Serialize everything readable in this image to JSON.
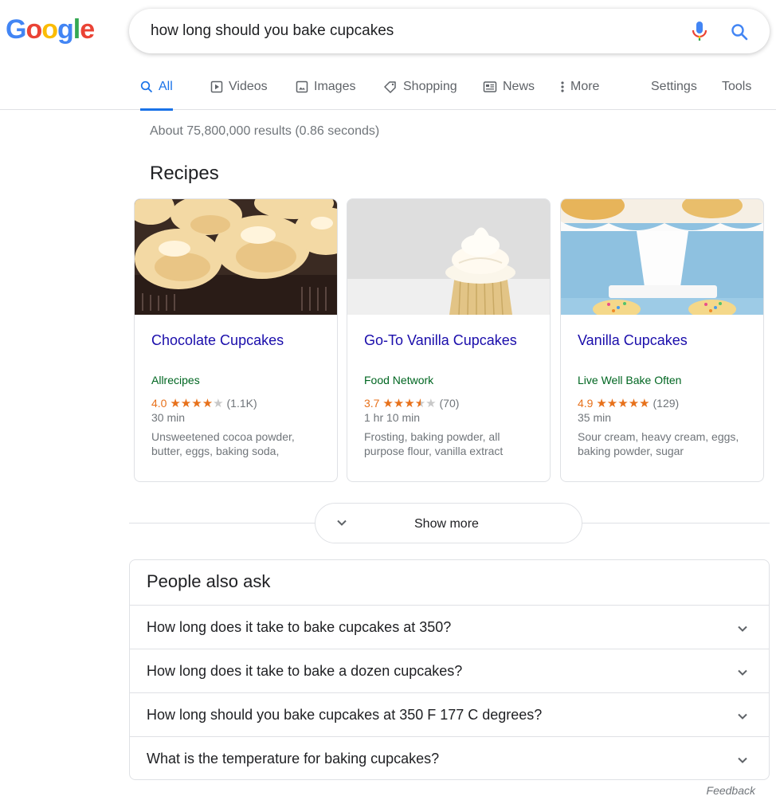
{
  "logo": {
    "letters": [
      "G",
      "o",
      "o",
      "g",
      "l",
      "e"
    ],
    "colors": [
      "#4285f4",
      "#ea4335",
      "#fbbc05",
      "#4285f4",
      "#34a853",
      "#ea4335"
    ]
  },
  "search": {
    "query": "how long should you bake cupcakes"
  },
  "tabs": [
    {
      "label": "All",
      "icon": "search-icon",
      "active": true
    },
    {
      "label": "Videos",
      "icon": "play-icon"
    },
    {
      "label": "Images",
      "icon": "image-icon"
    },
    {
      "label": "Shopping",
      "icon": "tag-icon"
    },
    {
      "label": "News",
      "icon": "news-icon"
    },
    {
      "label": "More",
      "icon": "more-vert-icon"
    },
    {
      "label": "Settings"
    },
    {
      "label": "Tools"
    }
  ],
  "results_stats": "About 75,800,000 results (0.86 seconds)",
  "recipes": {
    "heading": "Recipes",
    "cards": [
      {
        "title": "Chocolate Cupcakes",
        "source": "Allrecipes",
        "rating": "4.0",
        "stars": 4.0,
        "count": "(1.1K)",
        "time": "30 min",
        "ingredients": "Unsweetened cocoa powder, butter, eggs, baking soda,"
      },
      {
        "title": "Go-To Vanilla Cupcakes",
        "source": "Food Network",
        "rating": "3.7",
        "stars": 3.7,
        "count": "(70)",
        "time": "1 hr 10 min",
        "ingredients": "Frosting, baking powder, all purpose flour, vanilla extract"
      },
      {
        "title": "Vanilla Cupcakes",
        "source": "Live Well Bake Often",
        "rating": "4.9",
        "stars": 4.9,
        "count": "(129)",
        "time": "35 min",
        "ingredients": "Sour cream, heavy cream, eggs, baking powder, sugar"
      }
    ],
    "show_more": "Show more"
  },
  "people_also_ask": {
    "heading": "People also ask",
    "questions": [
      "How long does it take to bake cupcakes at 350?",
      "How long does it take to bake a dozen cupcakes?",
      "How long should you bake cupcakes at 350 F 177 C degrees?",
      "What is the temperature for baking cupcakes?"
    ]
  },
  "feedback": "Feedback",
  "colors": {
    "link": "#1a0dab",
    "source_green": "#006621",
    "accent_blue": "#1a73e8",
    "star_orange": "#e7711b"
  }
}
